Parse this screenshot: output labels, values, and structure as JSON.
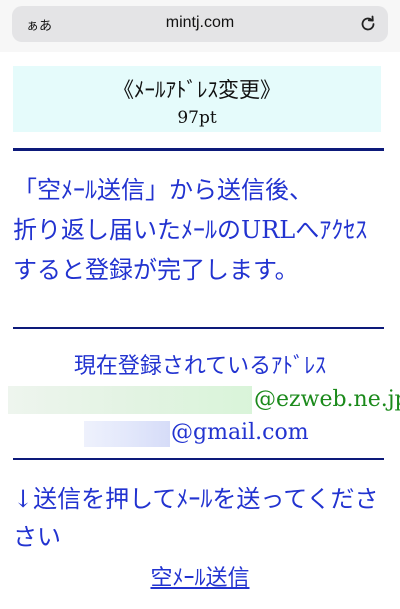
{
  "browser": {
    "text_size_label": "ぁあ",
    "domain": "mintj.com"
  },
  "header": {
    "title": "《ﾒｰﾙｱﾄﾞﾚｽ変更》",
    "points": "97pt"
  },
  "instructions": {
    "line1": "「空ﾒｰﾙ送信」から送信後、",
    "line2": "折り返し届いたﾒｰﾙのURLへｱｸｾｽ",
    "line3": "すると登録が完了します。"
  },
  "addresses": {
    "heading": "現在登録されているｱﾄﾞﾚｽ",
    "ezweb_domain": "@ezweb.ne.jp",
    "gmail_domain": "@gmail.com"
  },
  "send": {
    "instruction_line1": "↓送信を押してﾒｰﾙを送ってくださ",
    "instruction_line2": "さい",
    "link_label": "空ﾒｰﾙ送信"
  },
  "colors": {
    "text_blue": "#2233d0",
    "rule_navy": "#0d1a7a",
    "header_bg": "#e5fbfb",
    "ezweb_green": "#1b8a1b"
  }
}
